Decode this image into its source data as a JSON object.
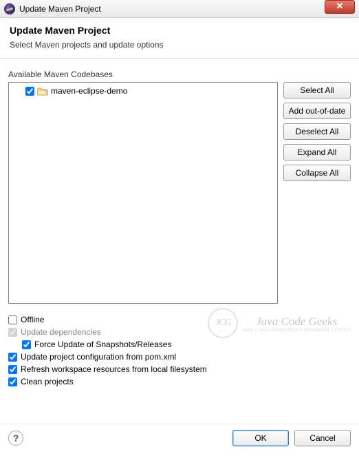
{
  "window": {
    "title": "Update Maven Project"
  },
  "header": {
    "title": "Update Maven Project",
    "subtitle": "Select Maven projects and update options"
  },
  "section": {
    "available_label": "Available Maven Codebases"
  },
  "tree": {
    "items": [
      {
        "label": "maven-eclipse-demo",
        "checked": true
      }
    ]
  },
  "buttons": {
    "select_all": "Select All",
    "add_out_of_date": "Add out-of-date",
    "deselect_all": "Deselect All",
    "expand_all": "Expand All",
    "collapse_all": "Collapse All"
  },
  "options": {
    "offline": {
      "label": "Offline",
      "checked": false,
      "enabled": true
    },
    "update_deps": {
      "label": "Update dependencies",
      "checked": true,
      "enabled": false
    },
    "force_update": {
      "label": "Force Update of Snapshots/Releases",
      "checked": true,
      "enabled": true
    },
    "update_config": {
      "label": "Update project configuration from pom.xml",
      "checked": true,
      "enabled": true
    },
    "refresh_ws": {
      "label": "Refresh workspace resources from local filesystem",
      "checked": true,
      "enabled": true
    },
    "clean": {
      "label": "Clean projects",
      "checked": true,
      "enabled": true
    }
  },
  "watermark": {
    "badge": "JCG",
    "title": "Java Code Geeks",
    "subtitle": "JAVA 2 JAVA DEVELOPERS RESOURCE CENTER"
  },
  "footer": {
    "ok": "OK",
    "cancel": "Cancel"
  }
}
